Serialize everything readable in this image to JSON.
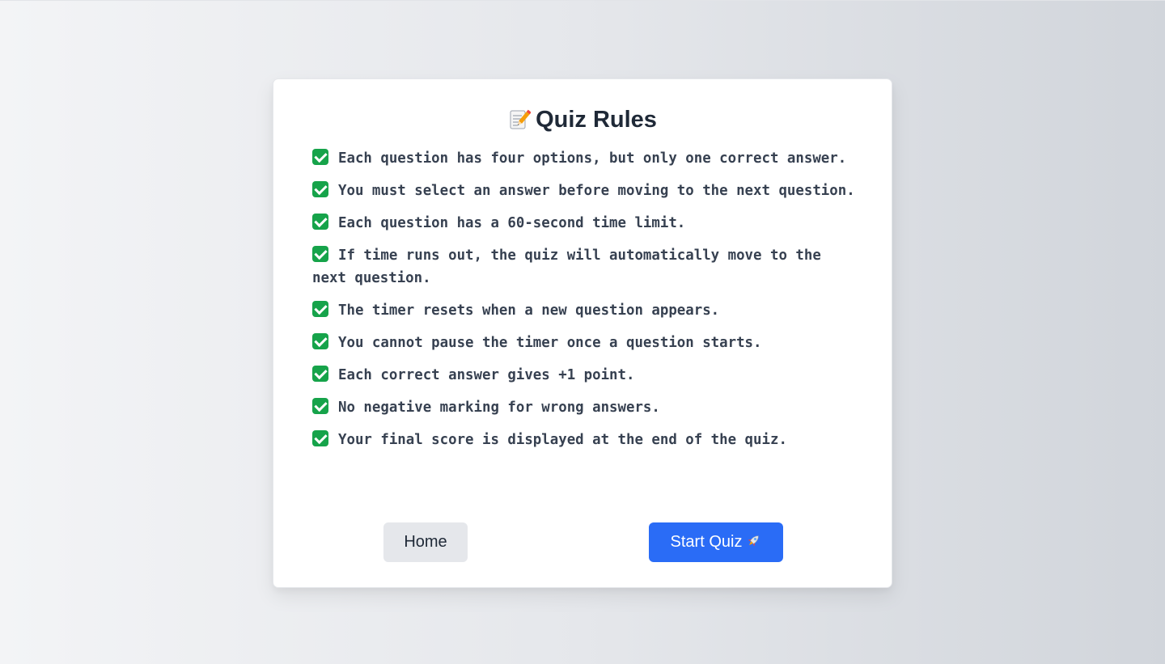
{
  "card": {
    "title": "Quiz Rules",
    "title_icon": "memo-pencil-icon"
  },
  "rules": [
    "Each question has four options, but only one correct answer.",
    "You must select an answer before moving to the next question.",
    "Each question has a 60-second time limit.",
    "If time runs out, the quiz will automatically move to the next question.",
    "The timer resets when a new question appears.",
    "You cannot pause the timer once a question starts.",
    "Each correct answer gives +1 point.",
    "No negative marking for wrong answers.",
    "Your final score is displayed at the end of the quiz."
  ],
  "rule_icon": "check-mark-icon",
  "buttons": {
    "home_label": "Home",
    "start_label": "Start Quiz",
    "start_icon": "rocket-icon"
  },
  "colors": {
    "primary": "#2a6cf6",
    "check": "#16a34a",
    "text": "#374151",
    "heading": "#1f2937"
  }
}
